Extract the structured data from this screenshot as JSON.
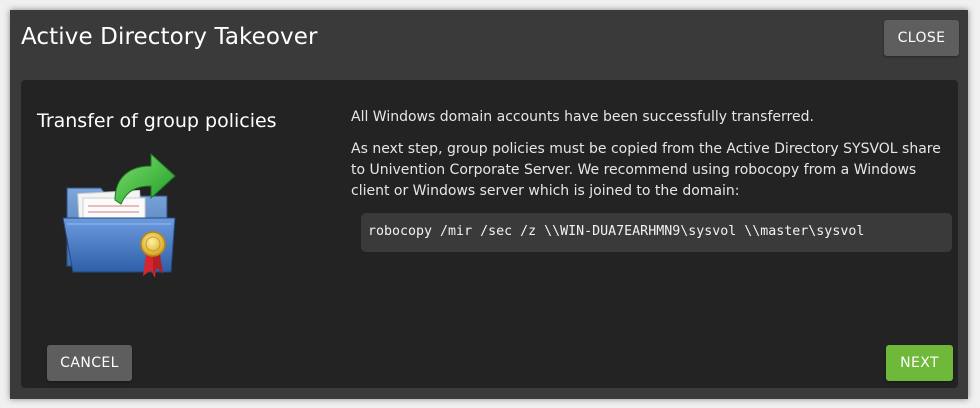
{
  "dialog": {
    "title": "Active Directory Takeover",
    "close_label": "CLOSE"
  },
  "page": {
    "heading": "Transfer of group policies",
    "paragraph_1": "All Windows domain accounts have been successfully transferred.",
    "paragraph_2": "As next step, group policies must be copied from the Active Directory SYSVOL share to Univention Corporate Server. We recommend using robocopy from a Windows client or Windows server which is joined to the domain:",
    "command": "robocopy /mir /sec /z \\\\WIN-DUA7EARHMN9\\sysvol \\\\master\\sysvol",
    "illustration_icon": "folder-transfer-icon"
  },
  "footer": {
    "cancel_label": "CANCEL",
    "next_label": "NEXT"
  },
  "colors": {
    "dialog_bg": "#3a3a3a",
    "content_bg": "#232323",
    "button_grey": "#5e5e5e",
    "button_green": "#6fb93a",
    "code_bg": "#3a3a3a"
  }
}
